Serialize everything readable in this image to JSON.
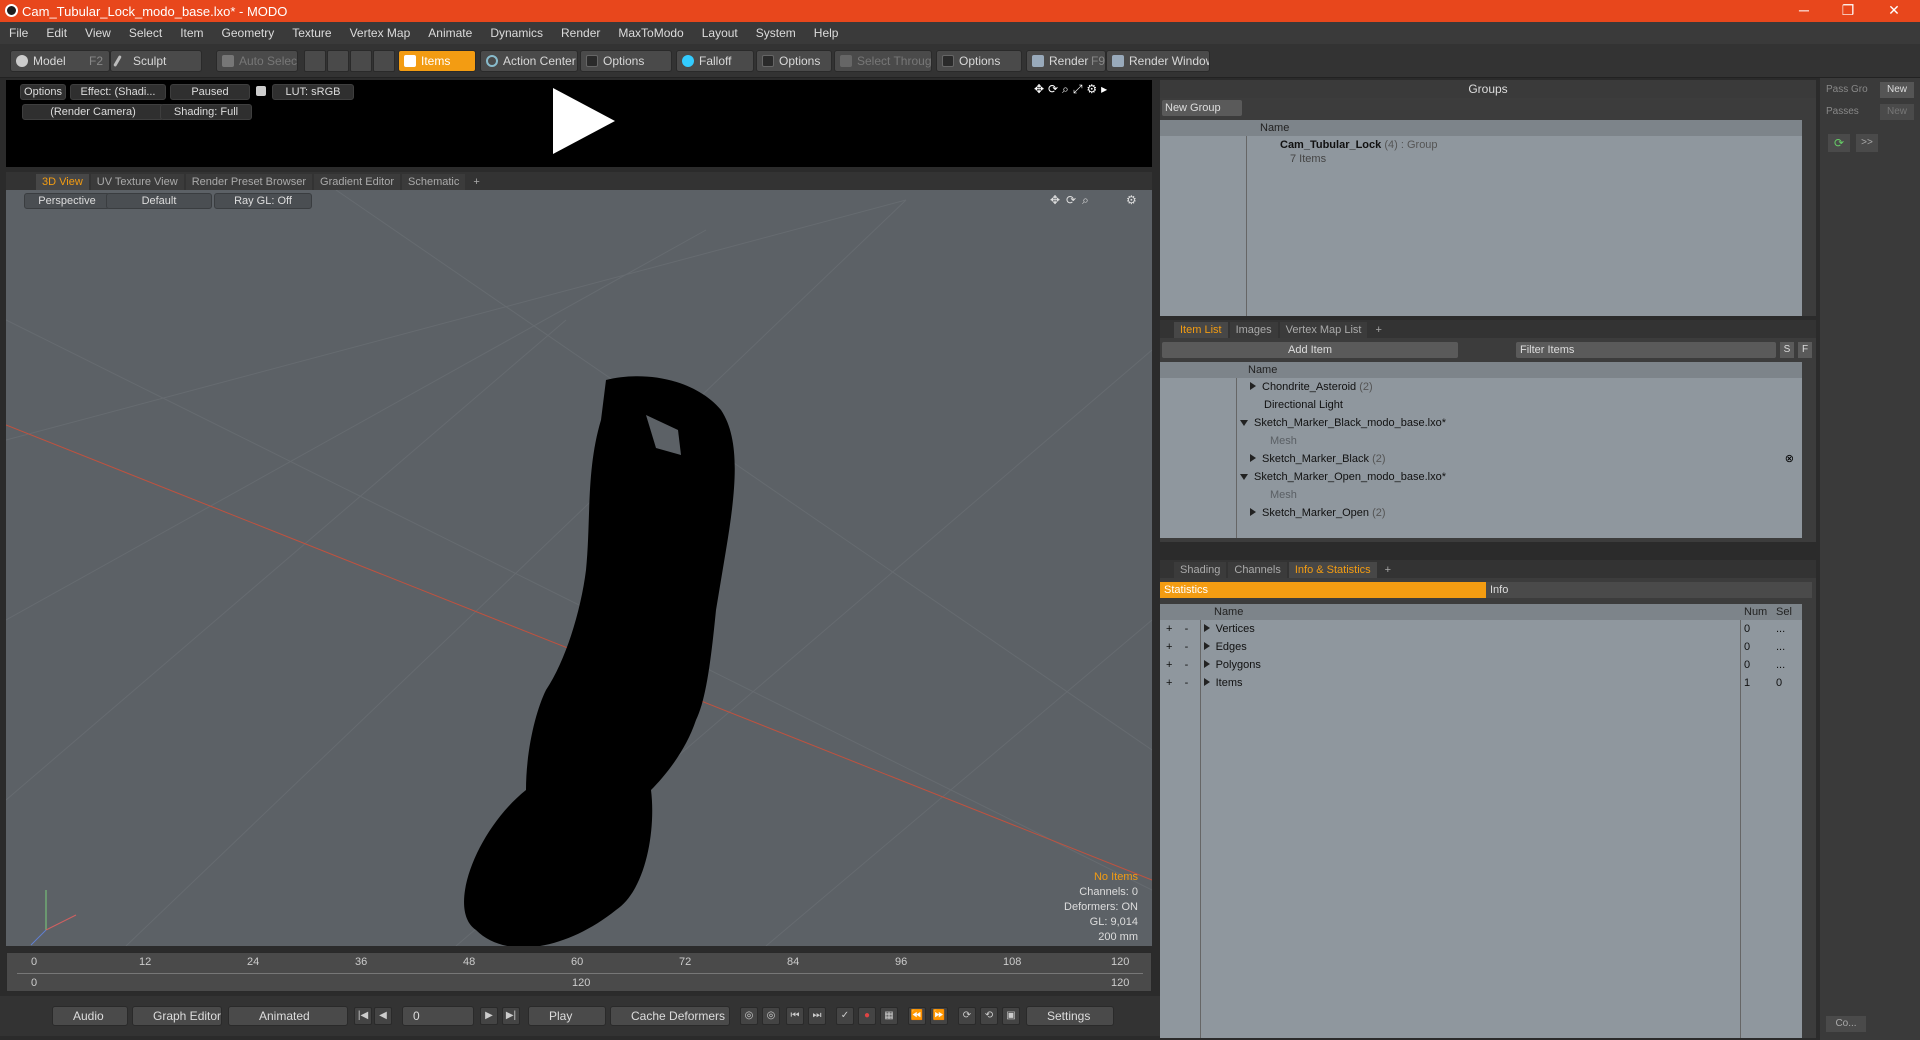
{
  "window": {
    "title": "Cam_Tubular_Lock_modo_base.lxo* - MODO",
    "minimize": "─",
    "maximize": "❐",
    "close": "✕"
  },
  "menu": [
    "File",
    "Edit",
    "View",
    "Select",
    "Item",
    "Geometry",
    "Texture",
    "Vertex Map",
    "Animate",
    "Dynamics",
    "Render",
    "MaxToModo",
    "Layout",
    "System",
    "Help"
  ],
  "toolbar": {
    "model": "Model",
    "model_key": "F2",
    "sculpt": "Sculpt",
    "auto_select": "Auto Select",
    "items": "Items",
    "action_center": "Action Center",
    "options1": "Options",
    "falloff": "Falloff",
    "options2": "Options",
    "select_through": "Select Through",
    "options3": "Options",
    "render": "Render",
    "render_key": "F9",
    "render_window": "Render Window"
  },
  "preview": {
    "options": "Options",
    "effect": "Effect: (Shadi...",
    "paused": "Paused",
    "lut": "LUT: sRGB",
    "camera": "(Render Camera)",
    "shading": "Shading: Full"
  },
  "viewport_tabs": [
    "3D View",
    "UV Texture View",
    "Render Preset Browser",
    "Gradient Editor",
    "Schematic",
    "+"
  ],
  "viewport": {
    "perspective": "Perspective",
    "default": "Default",
    "raygl": "Ray GL: Off",
    "no_items": "No Items",
    "channels": "Channels: 0",
    "deformers": "Deformers: ON",
    "gl": "GL: 9,014",
    "size": "200 mm"
  },
  "timeline": {
    "ticks": [
      "0",
      "12",
      "24",
      "36",
      "48",
      "60",
      "72",
      "84",
      "96",
      "108",
      "120"
    ],
    "start": "0",
    "mid": "120",
    "end": "120"
  },
  "bottom": {
    "audio": "Audio",
    "graph_editor": "Graph Editor",
    "animated": "Animated",
    "frame": "0",
    "play": "Play",
    "cache": "Cache Deformers",
    "settings": "Settings"
  },
  "groups": {
    "title": "Groups",
    "new_group": "New Group",
    "col_name": "Name",
    "group_name": "Cam_Tubular_Lock",
    "group_count": "(4)",
    "group_type": ": Group",
    "group_items": "7 Items"
  },
  "right_strip": {
    "pass_group": "Pass Gro",
    "passes": "Passes",
    "new1": "New",
    "new2": "New",
    "more": ">>",
    "co": "Co..."
  },
  "itemlist": {
    "tabs": [
      "Item List",
      "Images",
      "Vertex Map List",
      "+"
    ],
    "add_item": "Add Item",
    "filter": "Filter Items",
    "s": "S",
    "f": "F",
    "col_name": "Name",
    "rows": [
      {
        "label": "Chondrite_Asteroid",
        "count": "(2)"
      },
      {
        "label": "Directional Light",
        "count": ""
      },
      {
        "label": "Sketch_Marker_Black_modo_base.lxo*",
        "count": ""
      },
      {
        "label": "Mesh",
        "count": ""
      },
      {
        "label": "Sketch_Marker_Black",
        "count": "(2)"
      },
      {
        "label": "Sketch_Marker_Open_modo_base.lxo*",
        "count": ""
      },
      {
        "label": "Mesh",
        "count": ""
      },
      {
        "label": "Sketch_Marker_Open",
        "count": "(2)"
      }
    ]
  },
  "stats": {
    "tabs": [
      "Shading",
      "Channels",
      "Info & Statistics",
      "+"
    ],
    "sub_statistics": "Statistics",
    "sub_info": "Info",
    "col_name": "Name",
    "col_num": "Num",
    "col_sel": "Sel",
    "rows": [
      {
        "name": "Vertices",
        "num": "0",
        "sel": "..."
      },
      {
        "name": "Edges",
        "num": "0",
        "sel": "..."
      },
      {
        "name": "Polygons",
        "num": "0",
        "sel": "..."
      },
      {
        "name": "Items",
        "num": "1",
        "sel": "0"
      }
    ]
  },
  "colors": {
    "accent": "#f39c12",
    "titlebar": "#e8471c",
    "viewport": "#5c6166"
  }
}
